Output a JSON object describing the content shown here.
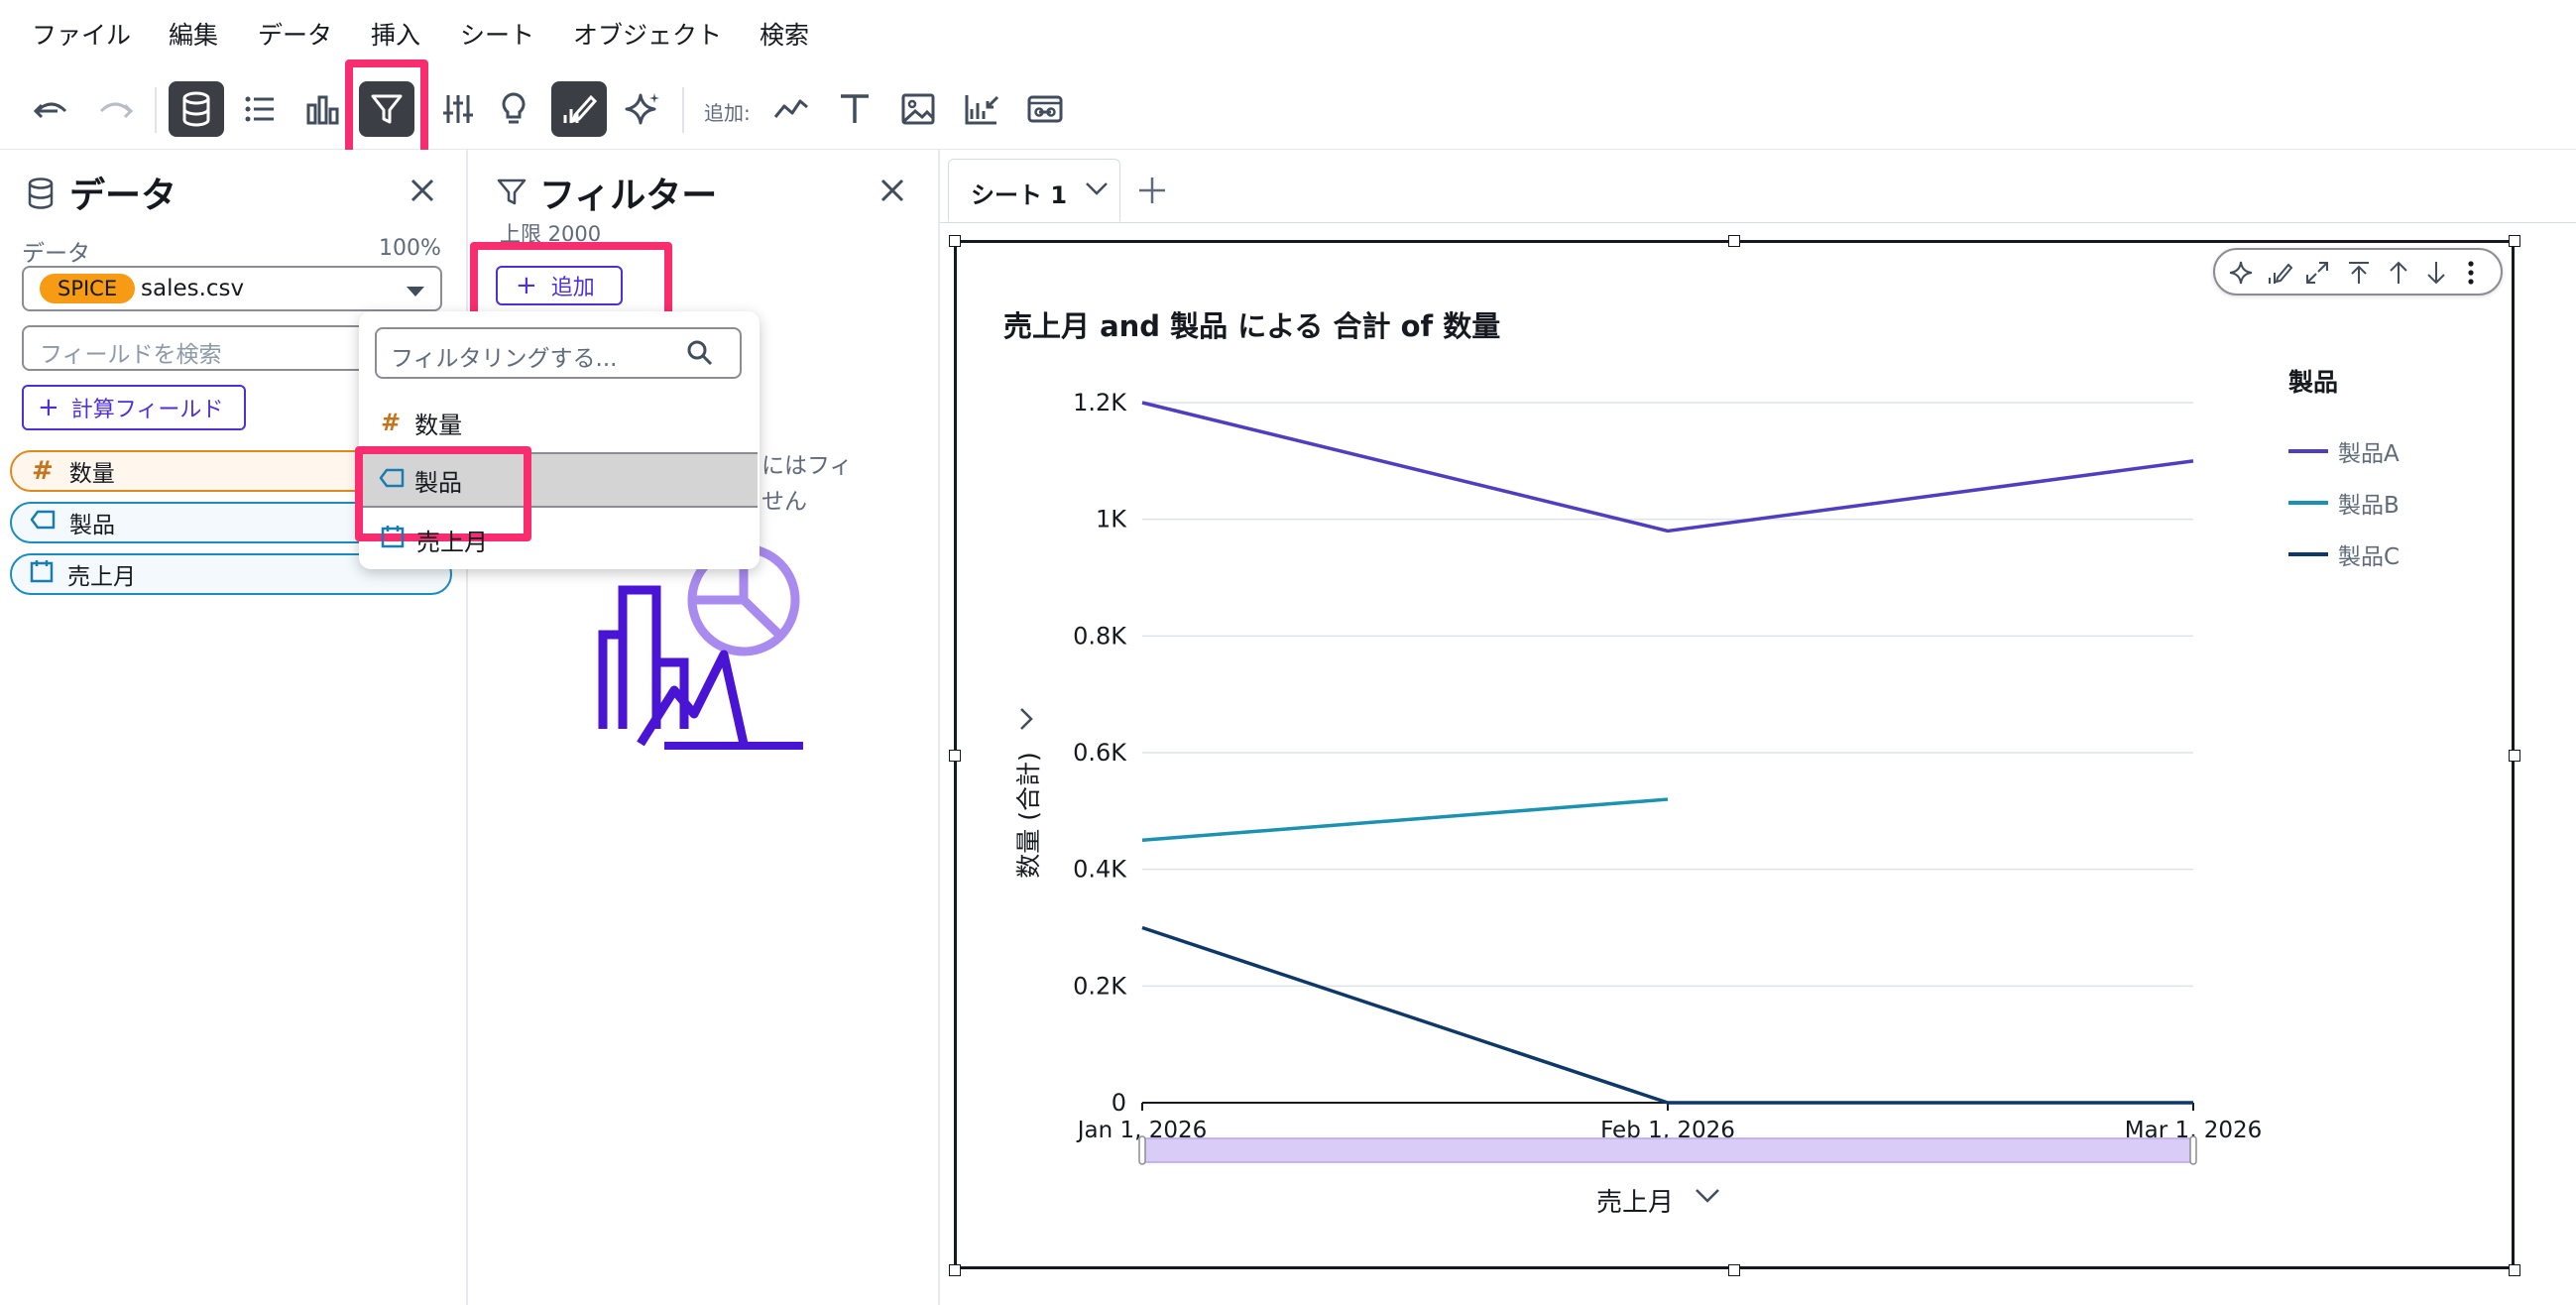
{
  "menu": [
    "ファイル",
    "編集",
    "データ",
    "挿入",
    "シート",
    "オブジェクト",
    "検索"
  ],
  "toolbar": {
    "add_label": "追加:"
  },
  "data_panel": {
    "title": "データ",
    "dataset_label": "データ",
    "dataset_percent": "100%",
    "spice_badge": "SPICE",
    "dataset_name": "sales.csv",
    "search_placeholder": "フィールドを検索",
    "calc_field_label": "計算フィールド",
    "fields": [
      "数量",
      "製品",
      "売上月"
    ]
  },
  "filter_panel": {
    "title": "フィルター",
    "limit_text": "上限 2000",
    "add_label": "追加",
    "empty_text_line1": "にはフィ",
    "empty_text_line2": "せん"
  },
  "filter_dropdown": {
    "search_placeholder": "フィルタリングする...",
    "items": [
      "数量",
      "製品",
      "売上月"
    ]
  },
  "sheet": {
    "tab_label": "シート 1"
  },
  "colors": {
    "series_a": "#4f3fc0",
    "series_b": "#1a92b0",
    "series_c": "#0d3868",
    "highlight": "#f72d6f",
    "primary": "#4f2fd8",
    "spice": "#f89b14"
  },
  "chart_data": {
    "type": "line",
    "title": "売上月 and 製品 による 合計 of 数量",
    "xlabel": "売上月",
    "ylabel": "数量 (合計)",
    "legend_title": "製品",
    "legend_position": "right",
    "x": [
      "Jan 1, 2026",
      "Feb 1, 2026",
      "Mar 1, 2026"
    ],
    "ylim": [
      0,
      1200
    ],
    "y_ticks": [
      "0",
      "0.2K",
      "0.4K",
      "0.6K",
      "0.8K",
      "1K",
      "1.2K"
    ],
    "grid": true,
    "series": [
      {
        "name": "製品A",
        "values": [
          1200,
          980,
          1100
        ]
      },
      {
        "name": "製品B",
        "values": [
          450,
          520,
          null
        ]
      },
      {
        "name": "製品C",
        "values": [
          300,
          0,
          0
        ]
      }
    ]
  }
}
